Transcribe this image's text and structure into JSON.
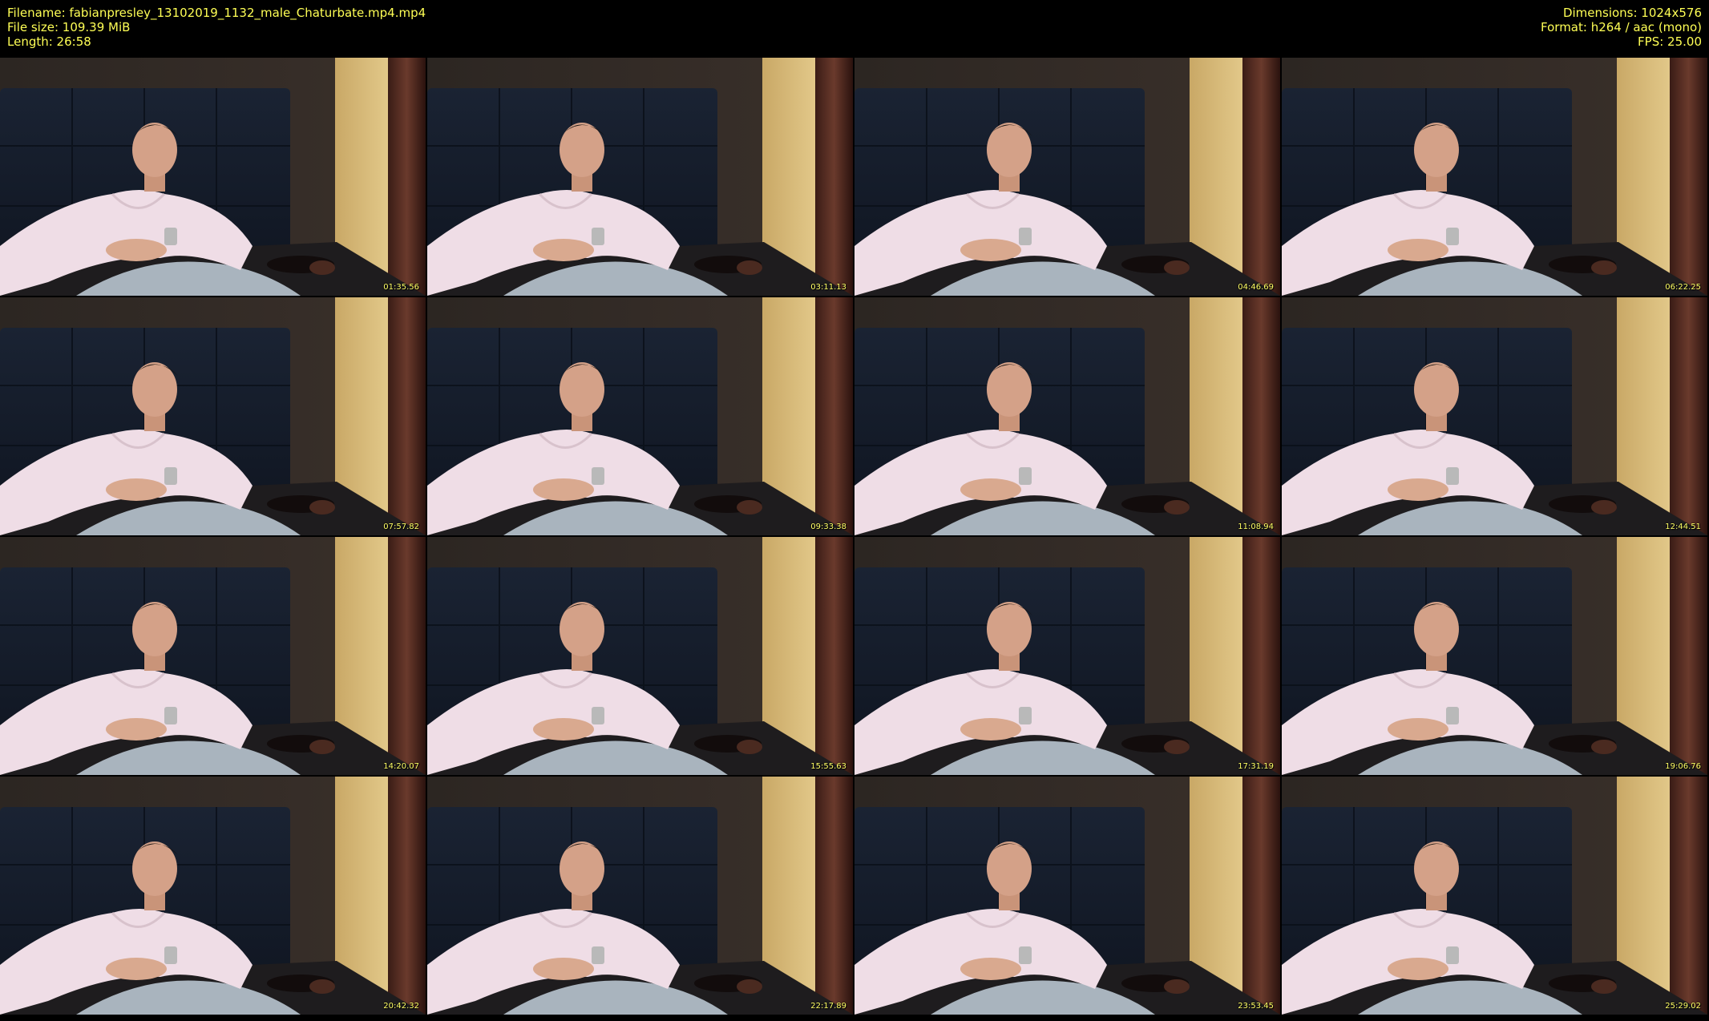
{
  "header": {
    "filename_label": "Filename: fabianpresley_13102019_1132_male_Chaturbate.mp4.mp4",
    "filesize_label": "File size: 109.39 MiB",
    "length_label": "Length: 26:58",
    "dimensions_label": "Dimensions: 1024x576",
    "format_label": "Format: h264 / aac (mono)",
    "fps_label": "FPS: 25.00"
  },
  "colors": {
    "header_text": "#ffff55",
    "timestamp_text": "#ffff66",
    "background": "#000000"
  },
  "thumbnails": [
    {
      "timestamp": "01:35.56"
    },
    {
      "timestamp": "03:11.13"
    },
    {
      "timestamp": "04:46.69"
    },
    {
      "timestamp": "06:22.25"
    },
    {
      "timestamp": "07:57.82"
    },
    {
      "timestamp": "09:33.38"
    },
    {
      "timestamp": "11:08.94"
    },
    {
      "timestamp": "12:44.51"
    },
    {
      "timestamp": "14:20.07"
    },
    {
      "timestamp": "15:55.63"
    },
    {
      "timestamp": "17:31.19"
    },
    {
      "timestamp": "19:06.76"
    },
    {
      "timestamp": "20:42.32"
    },
    {
      "timestamp": "22:17.89"
    },
    {
      "timestamp": "23:53.45"
    },
    {
      "timestamp": "25:29.02"
    }
  ]
}
